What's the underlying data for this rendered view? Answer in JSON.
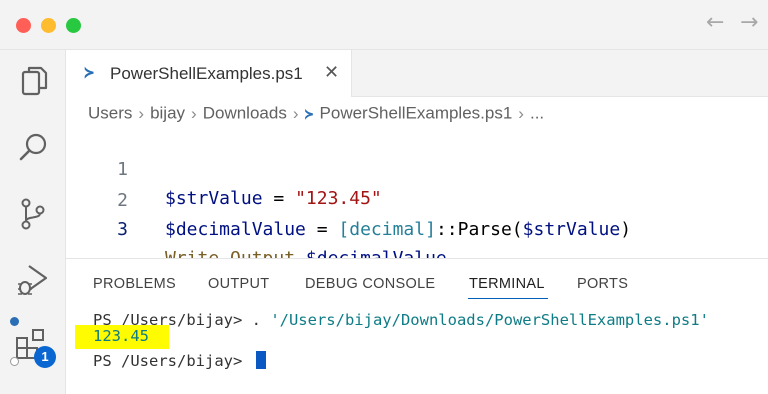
{
  "titlebar": {
    "back_icon": "arrow-left-icon",
    "forward_icon": "arrow-right-icon",
    "back_glyph": "←",
    "forward_glyph": "→"
  },
  "activity_bar": {
    "items": [
      "explorer-icon",
      "search-icon",
      "source-control-icon",
      "run-debug-icon",
      "extensions-icon"
    ],
    "extensions_badge": "1",
    "badge_color": "#0a66d0"
  },
  "tab": {
    "icon_glyph": "≻",
    "label": "PowerShellExamples.ps1",
    "close_glyph": "✕"
  },
  "breadcrumb": {
    "items": [
      "Users",
      "bijay",
      "Downloads",
      "PowerShellExamples.ps1",
      "..."
    ],
    "sep": "›"
  },
  "editor": {
    "lines": [
      {
        "num": "1",
        "tokens": [
          [
            "t-var",
            "$strValue"
          ],
          [
            "t-op",
            " = "
          ],
          [
            "t-str",
            "\"123.45\""
          ]
        ]
      },
      {
        "num": "2",
        "tokens": [
          [
            "t-var",
            "$decimalValue"
          ],
          [
            "t-op",
            " = "
          ],
          [
            "t-type",
            "[decimal]"
          ],
          [
            "t-op",
            "::Parse("
          ],
          [
            "t-var",
            "$strValue"
          ],
          [
            "t-op",
            ")"
          ]
        ]
      },
      {
        "num": "3",
        "tokens": [
          [
            "t-cmd",
            "Write-Output"
          ],
          [
            "t-op",
            " "
          ],
          [
            "t-var",
            "$decimalValue"
          ]
        ]
      }
    ],
    "active_line": "3"
  },
  "panel": {
    "tabs": [
      "PROBLEMS",
      "OUTPUT",
      "DEBUG CONSOLE",
      "TERMINAL",
      "PORTS"
    ],
    "active_tab": "TERMINAL",
    "accent": "#005fb8"
  },
  "terminal": {
    "line1_prompt": "PS /Users/bijay> . ",
    "line1_path": "'/Users/bijay/Downloads/PowerShellExamples.ps1'",
    "output": "123.45",
    "line3_prompt": "PS /Users/bijay> ",
    "highlight_color": "#fffb00"
  }
}
